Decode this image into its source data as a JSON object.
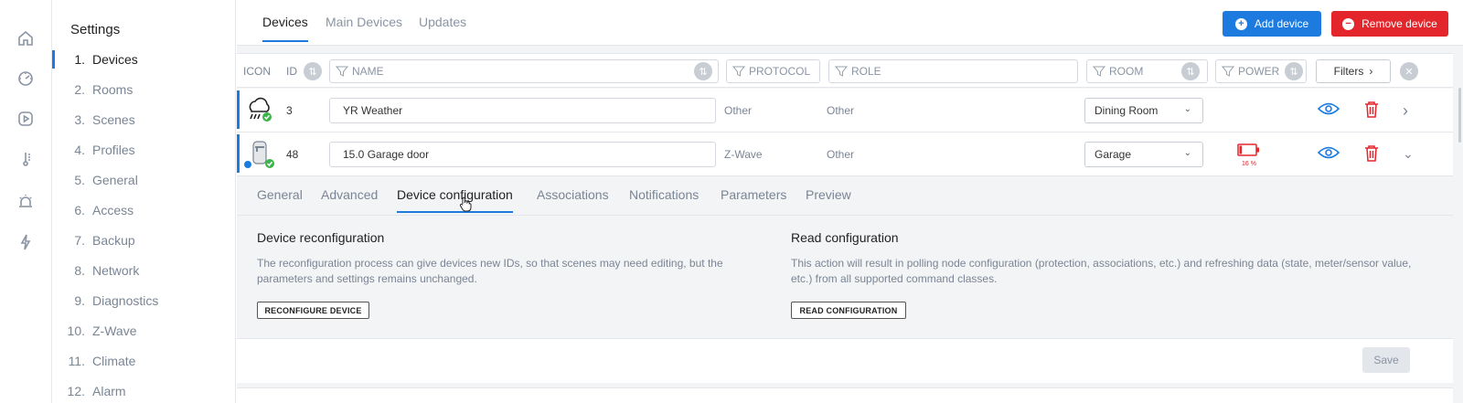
{
  "sidebar": {
    "title": "Settings",
    "items": [
      {
        "num": "1.",
        "label": "Devices"
      },
      {
        "num": "2.",
        "label": "Rooms"
      },
      {
        "num": "3.",
        "label": "Scenes"
      },
      {
        "num": "4.",
        "label": "Profiles"
      },
      {
        "num": "5.",
        "label": "General"
      },
      {
        "num": "6.",
        "label": "Access"
      },
      {
        "num": "7.",
        "label": "Backup"
      },
      {
        "num": "8.",
        "label": "Network"
      },
      {
        "num": "9.",
        "label": "Diagnostics"
      },
      {
        "num": "10.",
        "label": "Z-Wave"
      },
      {
        "num": "11.",
        "label": "Climate"
      },
      {
        "num": "12.",
        "label": "Alarm"
      }
    ]
  },
  "rail": {
    "icons": [
      "home-icon",
      "dashboard-icon",
      "play-icon",
      "thermometer-icon",
      "alarm-icon",
      "energy-icon"
    ]
  },
  "top": {
    "tabs": [
      "Devices",
      "Main Devices",
      "Updates"
    ],
    "add_label": "Add device",
    "remove_label": "Remove device"
  },
  "table": {
    "col_icon": "ICON",
    "col_id": "ID",
    "col_name": "NAME",
    "col_protocol": "PROTOCOL",
    "col_role": "ROLE",
    "col_room": "ROOM",
    "col_power": "POWER",
    "filters_label": "Filters",
    "rows": [
      {
        "id": "3",
        "name": "YR Weather",
        "protocol": "Other",
        "role": "Other",
        "room": "Dining Room"
      },
      {
        "id": "48",
        "name": "15.0 Garage door",
        "protocol": "Z-Wave",
        "role": "Other",
        "room": "Garage",
        "battery": "16 %",
        "battery_level": 16
      }
    ]
  },
  "panel": {
    "tabs": [
      "General",
      "Advanced",
      "Device configuration",
      "Associations",
      "Notifications",
      "Parameters",
      "Preview"
    ],
    "reconf_title": "Device reconfiguration",
    "reconf_desc_1": "The reconfiguration process can give devices new IDs, so that scenes may need editing, but the",
    "reconf_desc_2": "parameters and settings remains unchanged.",
    "reconf_btn": "RECONFIGURE DEVICE",
    "read_title": "Read configuration",
    "read_desc_1": "This action will result in polling node configuration (protection, associations, etc.) and refreshing data (state, meter/sensor value,",
    "read_desc_2": "etc.) from all supported command classes.",
    "read_btn": "READ CONFIGURATION",
    "save_label": "Save"
  },
  "colors": {
    "accent": "#1d7be0",
    "danger": "#e3262b",
    "success": "#3cb44a"
  }
}
